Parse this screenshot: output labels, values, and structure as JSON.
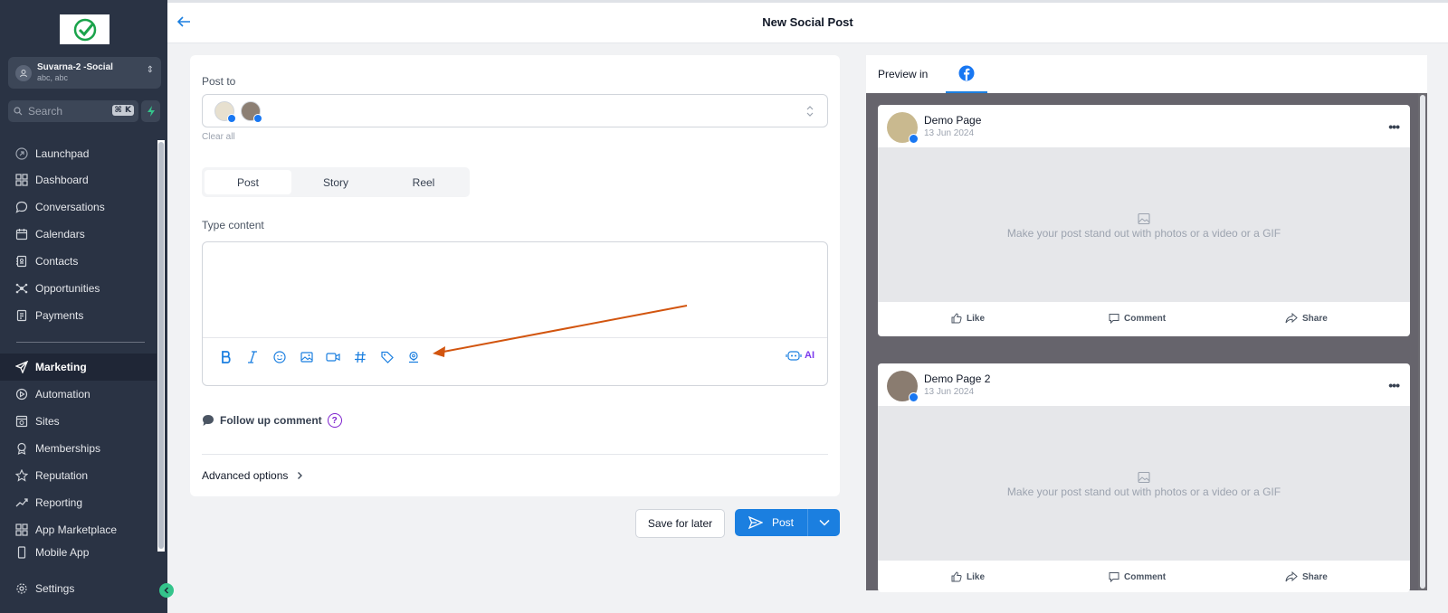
{
  "sidebar": {
    "account": {
      "name": "Suvarna-2 -Social",
      "sub": "abc, abc"
    },
    "search": {
      "placeholder": "Search",
      "shortcut": "⌘ K"
    },
    "items": [
      {
        "label": "Launchpad",
        "icon": "rocket-icon"
      },
      {
        "label": "Dashboard",
        "icon": "grid-icon"
      },
      {
        "label": "Conversations",
        "icon": "chat-icon"
      },
      {
        "label": "Calendars",
        "icon": "calendar-icon"
      },
      {
        "label": "Contacts",
        "icon": "contacts-icon"
      },
      {
        "label": "Opportunities",
        "icon": "network-icon"
      },
      {
        "label": "Payments",
        "icon": "receipt-icon"
      },
      {
        "label": "Marketing",
        "icon": "send-icon",
        "active": true
      },
      {
        "label": "Automation",
        "icon": "automation-icon"
      },
      {
        "label": "Sites",
        "icon": "sites-icon"
      },
      {
        "label": "Memberships",
        "icon": "award-icon"
      },
      {
        "label": "Reputation",
        "icon": "star-icon"
      },
      {
        "label": "Reporting",
        "icon": "trend-icon"
      },
      {
        "label": "App Marketplace",
        "icon": "apps-icon"
      },
      {
        "label": "Mobile App",
        "icon": "phone-icon"
      }
    ],
    "settings": "Settings"
  },
  "header": {
    "title": "New Social Post"
  },
  "form": {
    "post_to_label": "Post to",
    "clear_all": "Clear all",
    "tabs": [
      "Post",
      "Story",
      "Reel"
    ],
    "content_label": "Type content",
    "ai_label": "AI",
    "follow_up": "Follow up comment",
    "help": "?",
    "advanced": "Advanced options"
  },
  "actions": {
    "save": "Save for later",
    "post": "Post"
  },
  "preview": {
    "label": "Preview in",
    "cards": [
      {
        "name": "Demo Page",
        "date": "13 Jun 2024",
        "media_text": "Make your post stand out with photos or a video or a GIF"
      },
      {
        "name": "Demo Page 2",
        "date": "13 Jun 2024",
        "media_text": "Make your post stand out with photos or a video or a GIF"
      }
    ],
    "like": "Like",
    "comment": "Comment",
    "share": "Share"
  },
  "colors": {
    "accent": "#1b7fe0",
    "sidebar": "#2a3344",
    "annotation": "#d2550f",
    "success": "#34c48b",
    "facebook": "#1877f2"
  }
}
